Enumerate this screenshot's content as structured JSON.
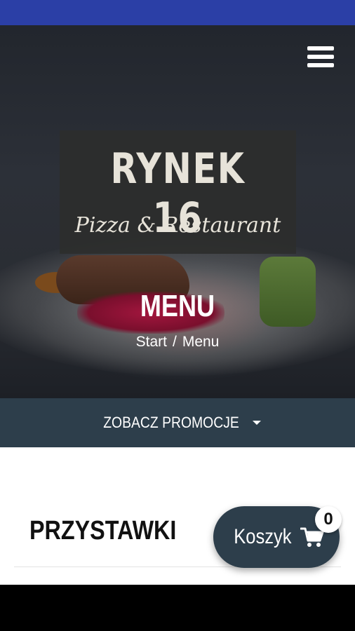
{
  "hero": {
    "logo_title": "RYNEK 16",
    "logo_subtitle": "Pizza & Restaurant",
    "page_title": "MENU",
    "breadcrumb": {
      "home": "Start",
      "separator": "/",
      "current": "Menu"
    }
  },
  "promo": {
    "label": "ZOBACZ PROMOCJE"
  },
  "section": {
    "title": "PRZYSTAWKI"
  },
  "cart": {
    "label": "Koszyk",
    "count": "0"
  },
  "colors": {
    "status_bar": "#2b3fa6",
    "accent_dark": "#2d3e4b",
    "white": "#ffffff"
  },
  "icons": {
    "menu": "hamburger-menu-icon",
    "promo_caret": "caret-down-icon",
    "cart": "shopping-cart-icon"
  }
}
